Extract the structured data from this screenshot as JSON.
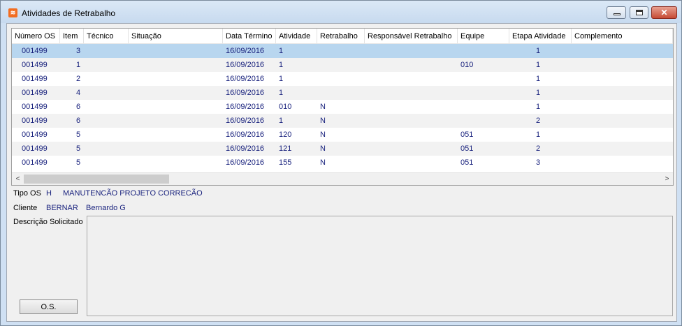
{
  "window": {
    "title": "Atividades de Retrabalho",
    "app_icon": "app-logo-icon",
    "close_glyph": "✕"
  },
  "grid": {
    "columns": [
      "Número OS",
      "Item",
      "Técnico",
      "Situação",
      "Data Término",
      "Atividade",
      "Retrabalho",
      "Responsável Retrabalho",
      "Equipe",
      "Etapa Atividade",
      "Complemento"
    ],
    "rows": [
      {
        "numero_os": "001499",
        "item": "3",
        "tecnico": "",
        "situacao": "",
        "data_termino": "16/09/2016",
        "atividade": "1",
        "retrabalho": "",
        "responsavel": "",
        "equipe": "",
        "etapa": "1",
        "complemento": ""
      },
      {
        "numero_os": "001499",
        "item": "1",
        "tecnico": "",
        "situacao": "",
        "data_termino": "16/09/2016",
        "atividade": "1",
        "retrabalho": "",
        "responsavel": "",
        "equipe": "010",
        "etapa": "1",
        "complemento": ""
      },
      {
        "numero_os": "001499",
        "item": "2",
        "tecnico": "",
        "situacao": "",
        "data_termino": "16/09/2016",
        "atividade": "1",
        "retrabalho": "",
        "responsavel": "",
        "equipe": "",
        "etapa": "1",
        "complemento": ""
      },
      {
        "numero_os": "001499",
        "item": "4",
        "tecnico": "",
        "situacao": "",
        "data_termino": "16/09/2016",
        "atividade": "1",
        "retrabalho": "",
        "responsavel": "",
        "equipe": "",
        "etapa": "1",
        "complemento": ""
      },
      {
        "numero_os": "001499",
        "item": "6",
        "tecnico": "",
        "situacao": "",
        "data_termino": "16/09/2016",
        "atividade": "010",
        "retrabalho": "N",
        "responsavel": "",
        "equipe": "",
        "etapa": "1",
        "complemento": ""
      },
      {
        "numero_os": "001499",
        "item": "6",
        "tecnico": "",
        "situacao": "",
        "data_termino": "16/09/2016",
        "atividade": "1",
        "retrabalho": "N",
        "responsavel": "",
        "equipe": "",
        "etapa": "2",
        "complemento": ""
      },
      {
        "numero_os": "001499",
        "item": "5",
        "tecnico": "",
        "situacao": "",
        "data_termino": "16/09/2016",
        "atividade": "120",
        "retrabalho": "N",
        "responsavel": "",
        "equipe": "051",
        "etapa": "1",
        "complemento": ""
      },
      {
        "numero_os": "001499",
        "item": "5",
        "tecnico": "",
        "situacao": "",
        "data_termino": "16/09/2016",
        "atividade": "121",
        "retrabalho": "N",
        "responsavel": "",
        "equipe": "051",
        "etapa": "2",
        "complemento": ""
      },
      {
        "numero_os": "001499",
        "item": "5",
        "tecnico": "",
        "situacao": "",
        "data_termino": "16/09/2016",
        "atividade": "155",
        "retrabalho": "N",
        "responsavel": "",
        "equipe": "051",
        "etapa": "3",
        "complemento": ""
      }
    ],
    "scroll_left_arrow": "<",
    "scroll_right_arrow": ">"
  },
  "details": {
    "tipo_os_label": "Tipo OS",
    "tipo_os_code": "H",
    "tipo_os_desc": "MANUTENCÃO PROJETO  CORRECÃO",
    "cliente_label": "Cliente",
    "cliente_code": "BERNAR",
    "cliente_name": "Bernardo G",
    "descricao_label": "Descrição Solicitado",
    "descricao_value": ""
  },
  "buttons": {
    "os_label": "O.S."
  },
  "colors": {
    "selection": "#b8d6ef",
    "value_text": "#1a237e",
    "client_bg": "#f0f0f0"
  }
}
